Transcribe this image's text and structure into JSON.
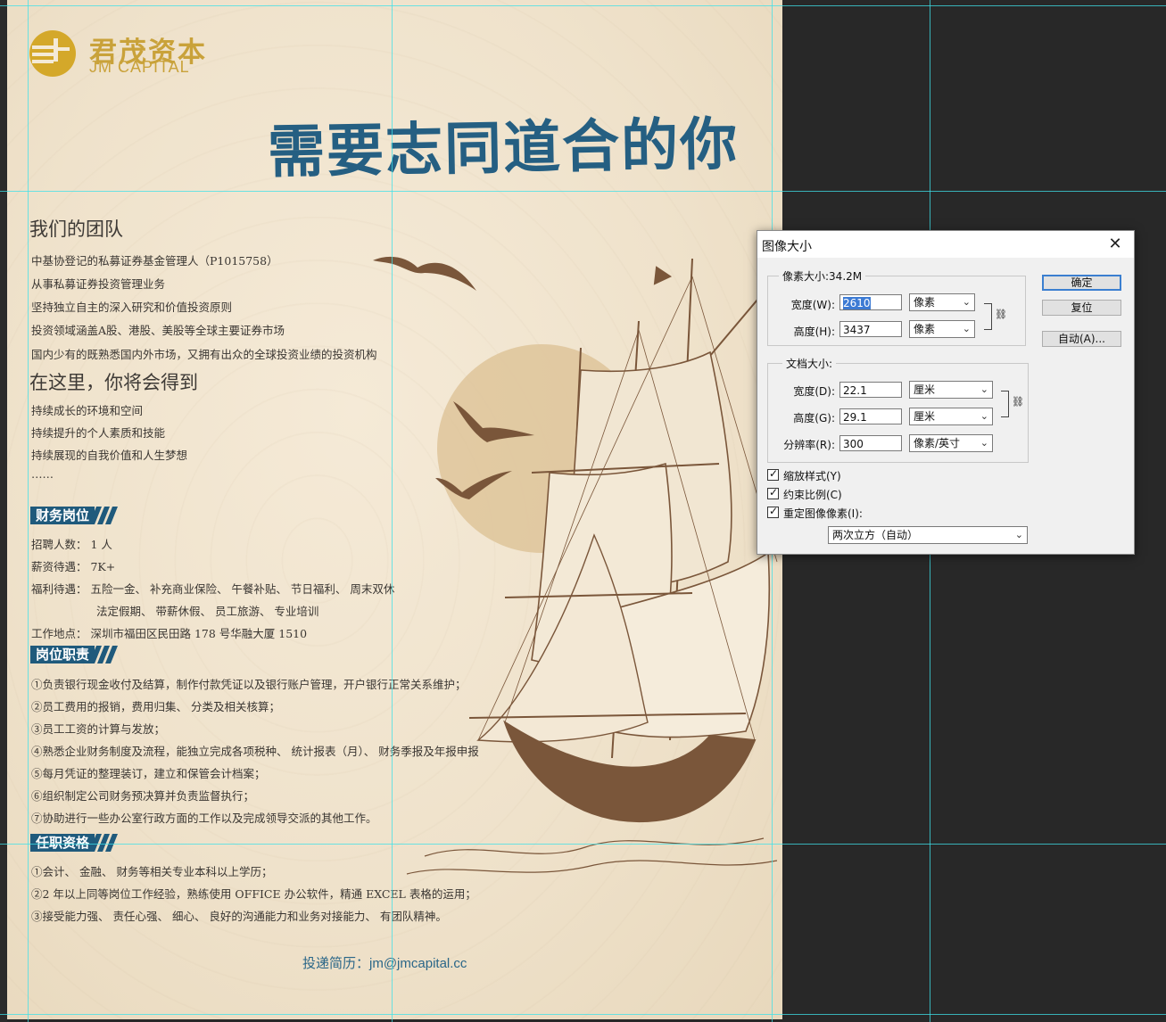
{
  "poster": {
    "brand_cn": "君茂资本",
    "brand_en": "JM CAPITAL",
    "headline": "需要志同道合的你",
    "team": {
      "title": "我们的团队",
      "lines": [
        "中基协登记的私募证券基金管理人（P1015758）",
        "从事私募证券投资管理业务",
        "坚持独立自主的深入研究和价值投资原则",
        "投资领域涵盖A股、港股、美股等全球主要证券市场",
        "国内少有的既熟悉国内外市场，又拥有出众的全球投资业绩的投资机构"
      ]
    },
    "gain": {
      "title": "在这里，你将会得到",
      "lines": [
        "持续成长的环境和空间",
        "持续提升的个人素质和技能",
        "持续展现的自我价值和人生梦想",
        "……"
      ]
    },
    "position": {
      "tag": "财务岗位",
      "headcount": "招聘人数： 1 人",
      "salary": "薪资待遇： 7K+",
      "benefits_1": "福利待遇： 五险一金、 补充商业保险、 午餐补贴、 节日福利、 周末双休",
      "benefits_2": "法定假期、 带薪休假、 员工旅游、 专业培训",
      "location": "工作地点： 深圳市福田区民田路 178 号华融大厦 1510"
    },
    "duties": {
      "tag": "岗位职责",
      "lines": [
        "①负责银行现金收付及结算，制作付款凭证以及银行账户管理，开户银行正常关系维护；",
        "②员工费用的报销，费用归集、 分类及相关核算；",
        "③员工工资的计算与发放；",
        "④熟悉企业财务制度及流程，能独立完成各项税种、 统计报表（月）、 财务季报及年报申报",
        "⑤每月凭证的整理装订，建立和保管会计档案；",
        "⑥组织制定公司财务预决算并负责监督执行；",
        "⑦协助进行一些办公室行政方面的工作以及完成领导交派的其他工作。"
      ]
    },
    "qualifications": {
      "tag": "任职资格",
      "lines": [
        "①会计、 金融、 财务等相关专业本科以上学历；",
        "②2 年以上同等岗位工作经验，熟练使用 OFFICE 办公软件，精通 EXCEL 表格的运用；",
        "③接受能力强、 责任心强、 细心、 良好的沟通能力和业务对接能力、 有团队精神。"
      ]
    },
    "contact": "投递简历：jm@jmcapital.cc",
    "colors": {
      "brand_gold": "#c9a23a",
      "headline_blue": "#255f82",
      "ship_brown": "#7a563a",
      "sun": "#dec49a"
    }
  },
  "dialog": {
    "title": "图像大小",
    "close_icon": "close-icon",
    "pixel_group": {
      "legend": "像素大小:34.2M",
      "width_label": "宽度(W):",
      "width_value": "2610",
      "width_unit": "像素",
      "height_label": "高度(H):",
      "height_value": "3437",
      "height_unit": "像素"
    },
    "doc_group": {
      "legend": "文档大小:",
      "width_label": "宽度(D):",
      "width_value": "22.1",
      "width_unit": "厘米",
      "height_label": "高度(G):",
      "height_value": "29.1",
      "height_unit": "厘米",
      "res_label": "分辨率(R):",
      "res_value": "300",
      "res_unit": "像素/英寸"
    },
    "checks": [
      "缩放样式(Y)",
      "约束比例(C)",
      "重定图像像素(I):"
    ],
    "resample": "两次立方（自动）",
    "buttons": {
      "ok": "确定",
      "reset": "复位",
      "auto": "自动(A)..."
    },
    "accent": "#3b7fd0"
  }
}
